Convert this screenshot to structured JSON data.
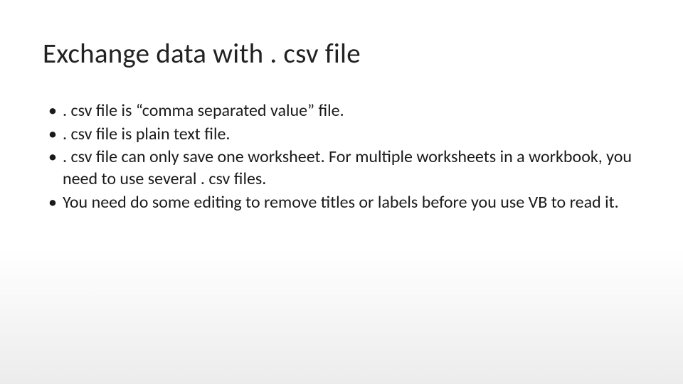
{
  "slide": {
    "title": "Exchange data with . csv file",
    "bullets": [
      ". csv file is “comma separated value” file.",
      ". csv file is plain text file.",
      ". csv file can only save one worksheet. For multiple worksheets in a workbook, you need to use several . csv files.",
      "You need do some editing to remove titles or labels before you use VB to read it."
    ]
  }
}
